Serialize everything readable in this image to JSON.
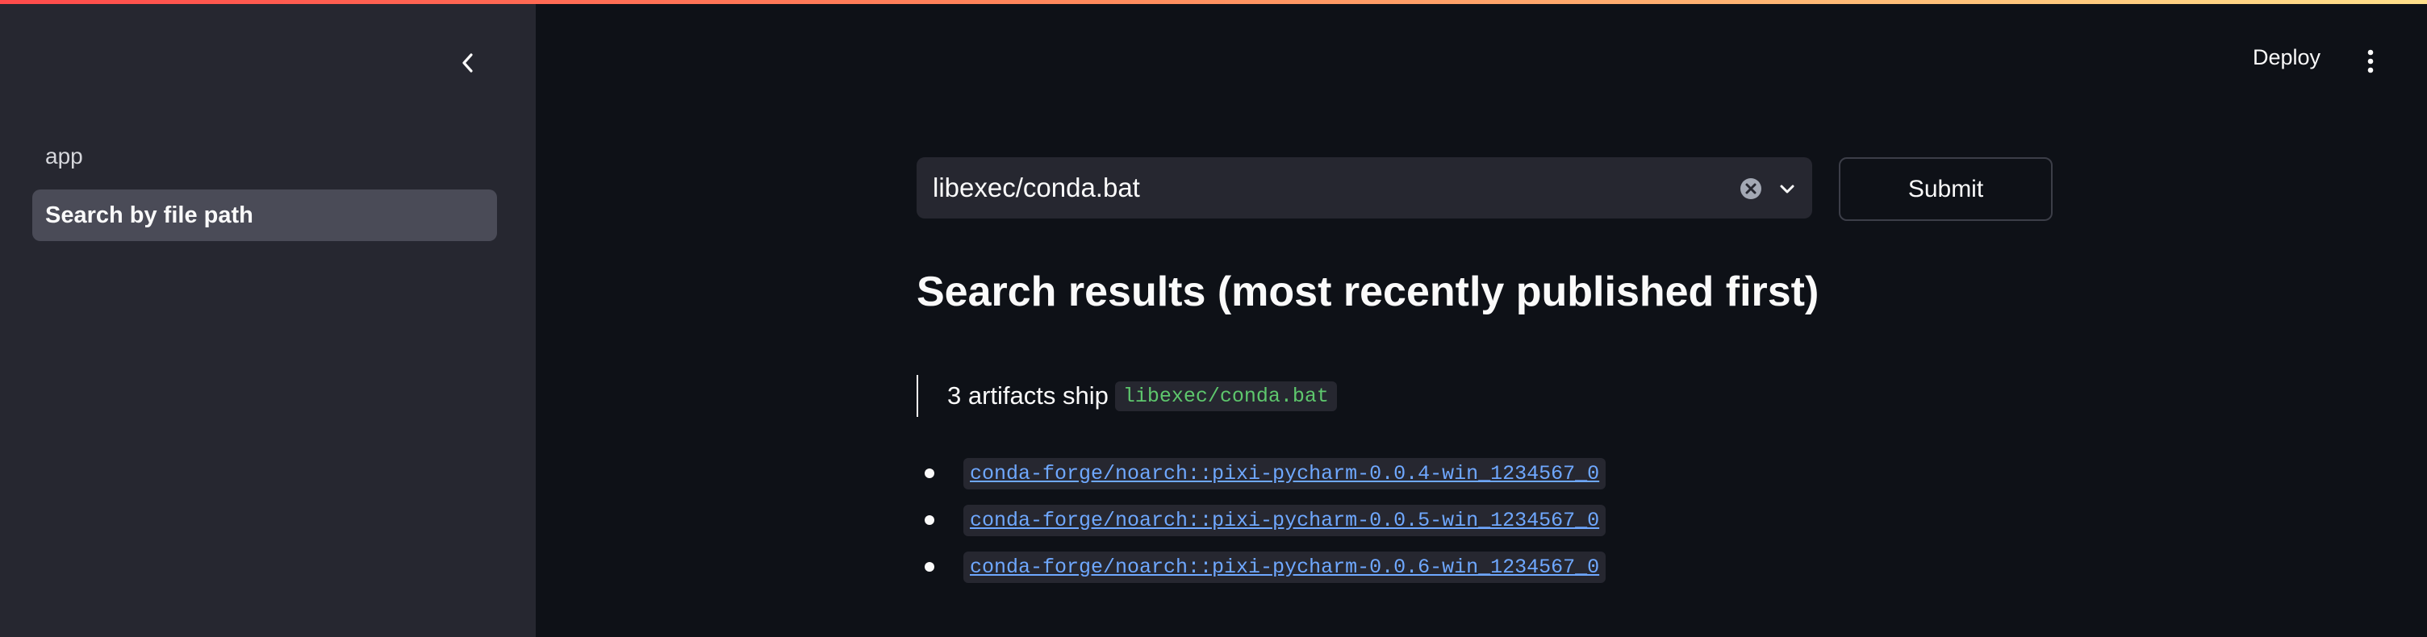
{
  "header": {
    "deploy_label": "Deploy",
    "menu_icon": "kebab-menu-icon"
  },
  "sidebar": {
    "collapse_icon": "chevron-left-icon",
    "items": [
      {
        "label": "app",
        "active": false
      },
      {
        "label": "Search by file path",
        "active": true
      }
    ]
  },
  "search": {
    "value": "libexec/conda.bat",
    "clear_icon": "clear-circle-icon",
    "dropdown_icon": "chevron-down-icon",
    "submit_label": "Submit"
  },
  "results": {
    "title": "Search results (most recently published first)",
    "summary_prefix": "3 artifacts ship",
    "summary_code": "libexec/conda.bat",
    "items": [
      "conda-forge/noarch::pixi-pycharm-0.0.4-win_1234567_0",
      "conda-forge/noarch::pixi-pycharm-0.0.5-win_1234567_0",
      "conda-forge/noarch::pixi-pycharm-0.0.6-win_1234567_0"
    ]
  },
  "colors": {
    "accent_gradient": [
      "#ff4b4b",
      "#ffe08a"
    ],
    "code_green": "#5ec76d",
    "link_blue": "#6fa8ff",
    "background": "#0e1117",
    "sidebar": "#262730"
  }
}
